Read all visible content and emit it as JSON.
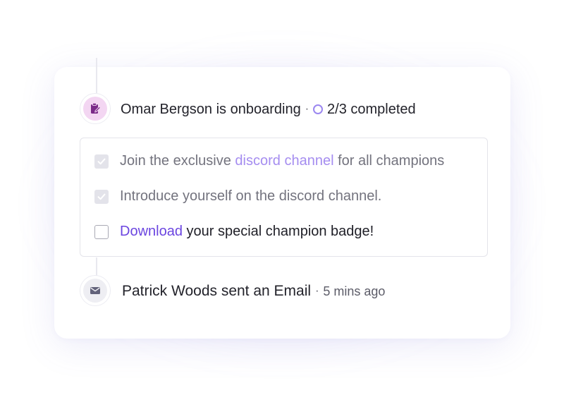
{
  "events": [
    {
      "icon": "clipboard-edit-icon",
      "title": "Omar Bergson is onboarding",
      "separator": "·",
      "progress_icon": "progress-ring-icon",
      "status": "2/3 completed"
    },
    {
      "icon": "mail-icon",
      "title": "Patrick Woods sent an Email",
      "separator": "·",
      "time": "5 mins ago"
    }
  ],
  "tasks": [
    {
      "checked": true,
      "text_before": "Join the exclusive ",
      "link": "discord channel",
      "text_after": " for all champions"
    },
    {
      "checked": true,
      "text": "Introduce yourself on the discord channel."
    },
    {
      "checked": false,
      "link": "Download",
      "text_after": " your special champion badge!"
    }
  ],
  "colors": {
    "accent": "#6b45e0",
    "accent_light": "#a58df0",
    "progress_ring": "#9b87f0",
    "onboarding_icon_bg": "#f3d6f2",
    "onboarding_icon": "#7a2a88",
    "mail_icon_bg": "#eeeef3",
    "mail_icon": "#62627a",
    "text_primary": "#23232b",
    "text_muted": "#73737e"
  }
}
